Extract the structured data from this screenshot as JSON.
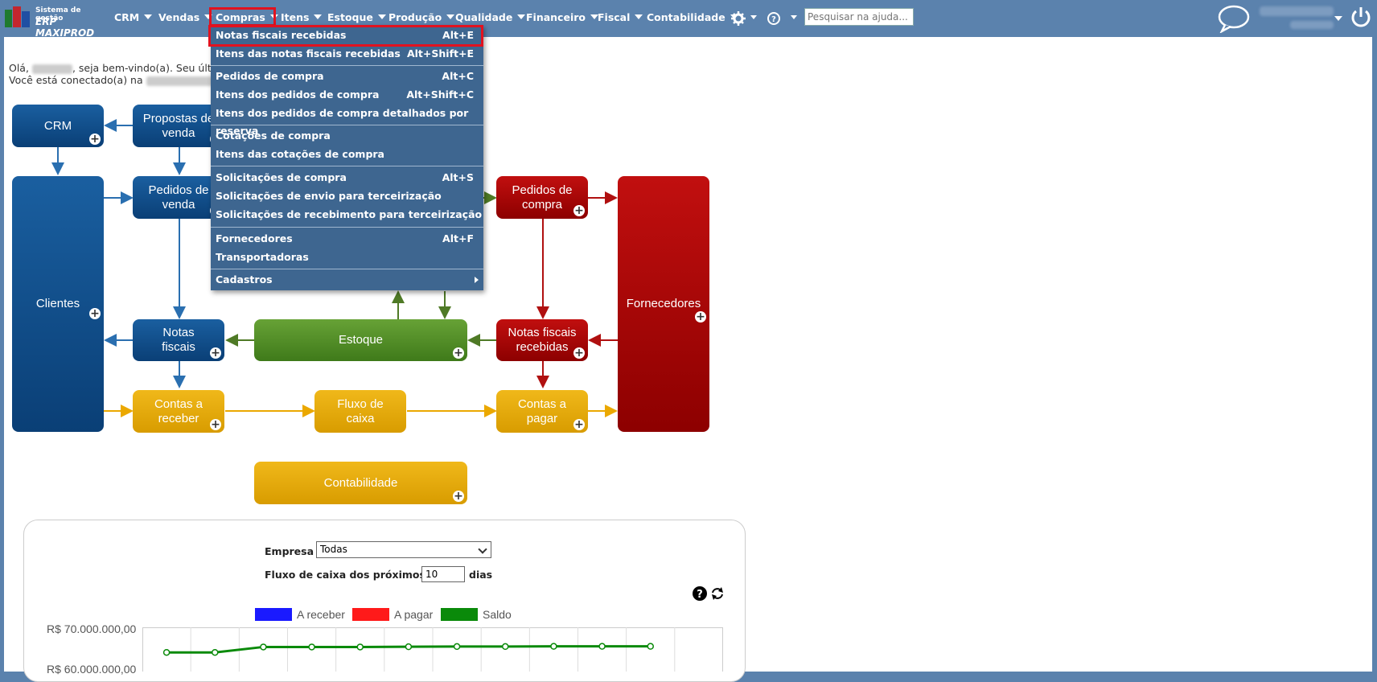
{
  "app": {
    "logo_line1": "Sistema de gestão",
    "logo_line2": "ERP MAXIPROD"
  },
  "nav": {
    "items": [
      "CRM",
      "Vendas",
      "Compras",
      "Itens",
      "Estoque",
      "Produção",
      "Qualidade",
      "Financeiro",
      "Fiscal",
      "Contabilidade"
    ],
    "active": "Compras",
    "search_placeholder": "Pesquisar na ajuda...",
    "icons": [
      "settings-gear-icon",
      "help-question-icon",
      "chat-bubble-icon",
      "power-icon"
    ]
  },
  "welcome": {
    "line1_prefix": "Olá,",
    "line1_suffix": ", seja bem-vindo(a). Seu últi",
    "line2_prefix": "Você está conectado(a) na"
  },
  "dropdown": {
    "groups": [
      [
        {
          "label": "Notas fiscais recebidas",
          "shortcut": "Alt+E",
          "highlighted": true
        },
        {
          "label": "Itens das notas fiscais recebidas",
          "shortcut": "Alt+Shift+E"
        }
      ],
      [
        {
          "label": "Pedidos de compra",
          "shortcut": "Alt+C"
        },
        {
          "label": "Itens dos pedidos de compra",
          "shortcut": "Alt+Shift+C"
        },
        {
          "label": "Itens dos pedidos de compra detalhados por reserva",
          "shortcut": ""
        }
      ],
      [
        {
          "label": "Cotações de compra",
          "shortcut": ""
        },
        {
          "label": "Itens das cotações de compra",
          "shortcut": ""
        }
      ],
      [
        {
          "label": "Solicitações de compra",
          "shortcut": "Alt+S"
        },
        {
          "label": "Solicitações de envio para terceirização",
          "shortcut": ""
        },
        {
          "label": "Solicitações de recebimento para terceirização",
          "shortcut": ""
        }
      ],
      [
        {
          "label": "Fornecedores",
          "shortcut": "Alt+F"
        },
        {
          "label": "Transportadoras",
          "shortcut": ""
        }
      ],
      [
        {
          "label": "Cadastros",
          "shortcut": "",
          "submenu": true
        }
      ]
    ]
  },
  "flow": {
    "crm": "CRM",
    "propostas": [
      "Propostas de",
      "venda"
    ],
    "clientes": "Clientes",
    "pedidos_venda": [
      "Pedidos de",
      "venda"
    ],
    "notas_fiscais": [
      "Notas",
      "fiscais"
    ],
    "estoque": "Estoque",
    "pedidos_compra": [
      "Pedidos de",
      "compra"
    ],
    "notas_recebidas": [
      "Notas fiscais",
      "recebidas"
    ],
    "fornecedores": "Fornecedores",
    "contas_receber": [
      "Contas a",
      "receber"
    ],
    "fluxo_caixa": [
      "Fluxo de",
      "caixa"
    ],
    "contas_pagar": [
      "Contas a",
      "pagar"
    ],
    "contabilidade": "Contabilidade",
    "colors": {
      "blue": "#0d4a86",
      "green": "#4f8a26",
      "red": "#a00000",
      "gold": "#e6a800"
    }
  },
  "cashflow": {
    "empresa_label": "Empresa",
    "empresa_value": "Todas",
    "dias_label": "Fluxo de caixa dos próximos",
    "dias_value": "10",
    "dias_suffix": "dias",
    "legend": [
      {
        "name": "A receber",
        "color": "#1a1aff"
      },
      {
        "name": "A pagar",
        "color": "#ff1a1a"
      },
      {
        "name": "Saldo",
        "color": "#0a8a0a"
      }
    ]
  },
  "chart_data": {
    "type": "line",
    "ytick_labels": [
      "R$ 70.000.000,00",
      "R$ 60.000.000,00"
    ],
    "series": [
      {
        "name": "Saldo",
        "values": [
          64000000,
          64000000,
          65300000,
          65300000,
          65300000,
          65350000,
          65400000,
          65400000,
          65450000,
          65450000,
          65450000
        ]
      }
    ]
  }
}
